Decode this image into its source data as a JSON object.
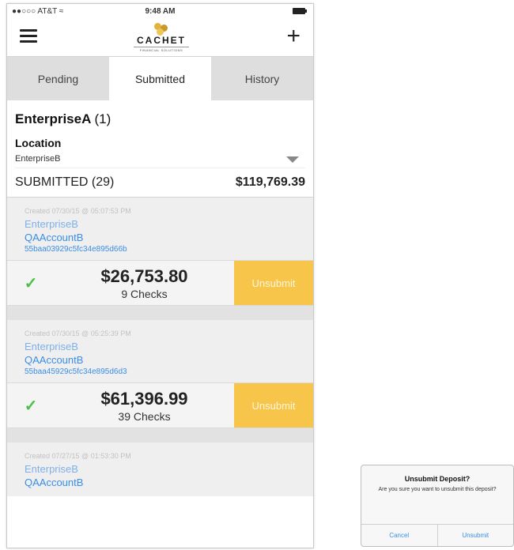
{
  "status_bar": {
    "carrier": "●●○○○ AT&T ≈",
    "time": "9:48 AM"
  },
  "logo": {
    "word": "CACHET",
    "sub": "FINANCIAL SOLUTIONS"
  },
  "tabs": [
    {
      "label": "Pending",
      "active": false
    },
    {
      "label": "Submitted",
      "active": true
    },
    {
      "label": "History",
      "active": false
    }
  ],
  "company": {
    "name": "EnterpriseA",
    "count": "(1)"
  },
  "location": {
    "label": "Location",
    "value": "EnterpriseB"
  },
  "summary": {
    "label": "SUBMITTED (29)",
    "total": "$119,769.39"
  },
  "deposits": [
    {
      "created": "Created 07/30/15 @ 05:07:53 PM",
      "entity": "EnterpriseB",
      "account": "QAAccountB",
      "hash": "55baa03929c5fc34e895d66b",
      "amount": "$26,753.80",
      "checks": "9 Checks",
      "action": "Unsubmit"
    },
    {
      "created": "Created 07/30/15 @ 05:25:39 PM",
      "entity": "EnterpriseB",
      "account": "QAAccountB",
      "hash": "55baa45929c5fc34e895d6d3",
      "amount": "$61,396.99",
      "checks": "39 Checks",
      "action": "Unsubmit"
    },
    {
      "created": "Created 07/27/15 @ 01:53:30 PM",
      "entity": "EnterpriseB",
      "account": "QAAccountB"
    }
  ],
  "alert": {
    "title": "Unsubmit Deposit?",
    "message": "Are you sure you want to unsubmit this deposit?",
    "cancel": "Cancel",
    "confirm": "Unsubmit"
  },
  "colors": {
    "accent": "#f6c54a",
    "link": "#3a8ee6",
    "check": "#4cbe4a"
  },
  "icons": {
    "menu": "hamburger-icon",
    "add": "plus-icon",
    "dropdown": "caret-down-icon",
    "checkmark": "checkmark-icon"
  }
}
